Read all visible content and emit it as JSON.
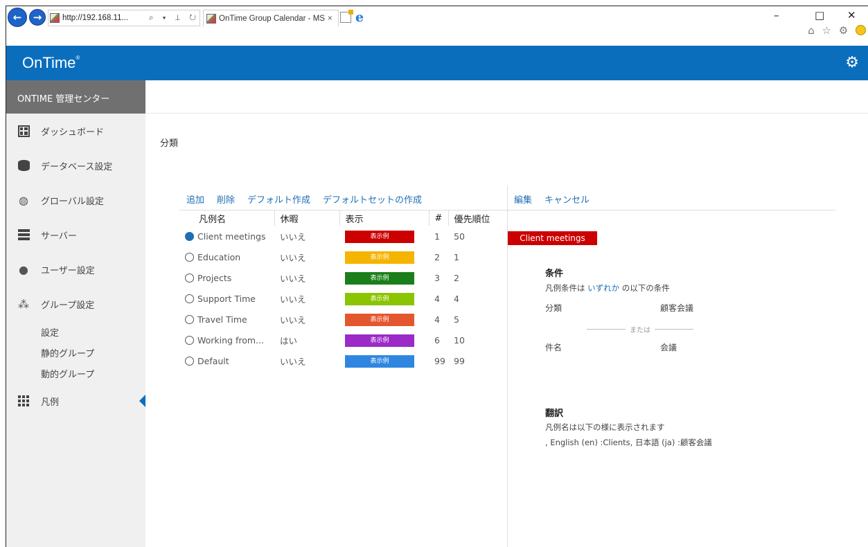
{
  "browser": {
    "url": "http://192.168.11...",
    "tab_title": "OnTime Group Calendar - MS",
    "tab_close": "×",
    "addr_icons": "⌕ ▾ ⊥ ↻",
    "window_min": "–",
    "window_max": "□",
    "window_close": "✕",
    "nav_back": "←",
    "nav_forward": "→",
    "tools": "⌂ ☆ ⚙"
  },
  "app": {
    "logo": "OnTime",
    "logo_mark": "®",
    "settings_icon": "gear-icon",
    "accent_color": "#0a6ebd"
  },
  "sidebar": {
    "title": "ONTIME 管理センター",
    "items": [
      {
        "label": "ダッシュボード",
        "icon": "dashboard-icon"
      },
      {
        "label": "データベース設定",
        "icon": "database-icon"
      },
      {
        "label": "グローバル設定",
        "icon": "globe-icon"
      },
      {
        "label": "サーバー",
        "icon": "server-icon"
      },
      {
        "label": "ユーザー設定",
        "icon": "user-icon"
      },
      {
        "label": "グループ設定",
        "icon": "group-icon"
      }
    ],
    "group_sub": [
      "設定",
      "静的グループ",
      "動的グループ"
    ],
    "legend_item": {
      "label": "凡例",
      "icon": "grid-icon"
    }
  },
  "main": {
    "breadcrumb": "分類",
    "toolbar": {
      "add": "追加",
      "delete": "削除",
      "create_default": "デフォルト作成",
      "create_default_set": "デフォルトセットの作成"
    },
    "right_toolbar": {
      "edit": "編集",
      "cancel": "キャンセル"
    },
    "columns": {
      "name": "凡例名",
      "holiday": "休暇",
      "display": "表示",
      "num": "#",
      "priority": "優先順位"
    },
    "rows": [
      {
        "name": "Client meetings",
        "holiday": "いいえ",
        "sample": "表示例",
        "color": "#cc0000",
        "num": "1",
        "priority": "50",
        "selected": true
      },
      {
        "name": "Education",
        "holiday": "いいえ",
        "sample": "表示例",
        "color": "#f5b400",
        "num": "2",
        "priority": "1",
        "selected": false
      },
      {
        "name": "Projects",
        "holiday": "いいえ",
        "sample": "表示例",
        "color": "#1a7f1a",
        "num": "3",
        "priority": "2",
        "selected": false
      },
      {
        "name": "Support Time",
        "holiday": "いいえ",
        "sample": "表示例",
        "color": "#8bc400",
        "num": "4",
        "priority": "4",
        "selected": false
      },
      {
        "name": "Travel Time",
        "holiday": "いいえ",
        "sample": "表示例",
        "color": "#e4572e",
        "num": "4",
        "priority": "5",
        "selected": false
      },
      {
        "name": "Working from...",
        "holiday": "はい",
        "sample": "表示例",
        "color": "#9b2ac7",
        "num": "6",
        "priority": "10",
        "selected": false
      },
      {
        "name": "Default",
        "holiday": "いいえ",
        "sample": "表示例",
        "color": "#2f86e0",
        "num": "99",
        "priority": "99",
        "selected": false
      }
    ],
    "detail": {
      "preview_label": "Client meetings",
      "preview_color": "#cc0000",
      "conditions_title": "条件",
      "conditions_prefix": "凡例条件は ",
      "conditions_link": "いずれか",
      "conditions_suffix": " の以下の条件",
      "cond1_key": "分類",
      "cond1_value": "顧客会議",
      "or_text": "または",
      "cond2_key": "件名",
      "cond2_value": "会議",
      "translation_title": "翻訳",
      "translation_sub": "凡例名は以下の様に表示されます",
      "translation_value": ", English (en) :Clients, 日本語 (ja) :顧客会議"
    }
  }
}
